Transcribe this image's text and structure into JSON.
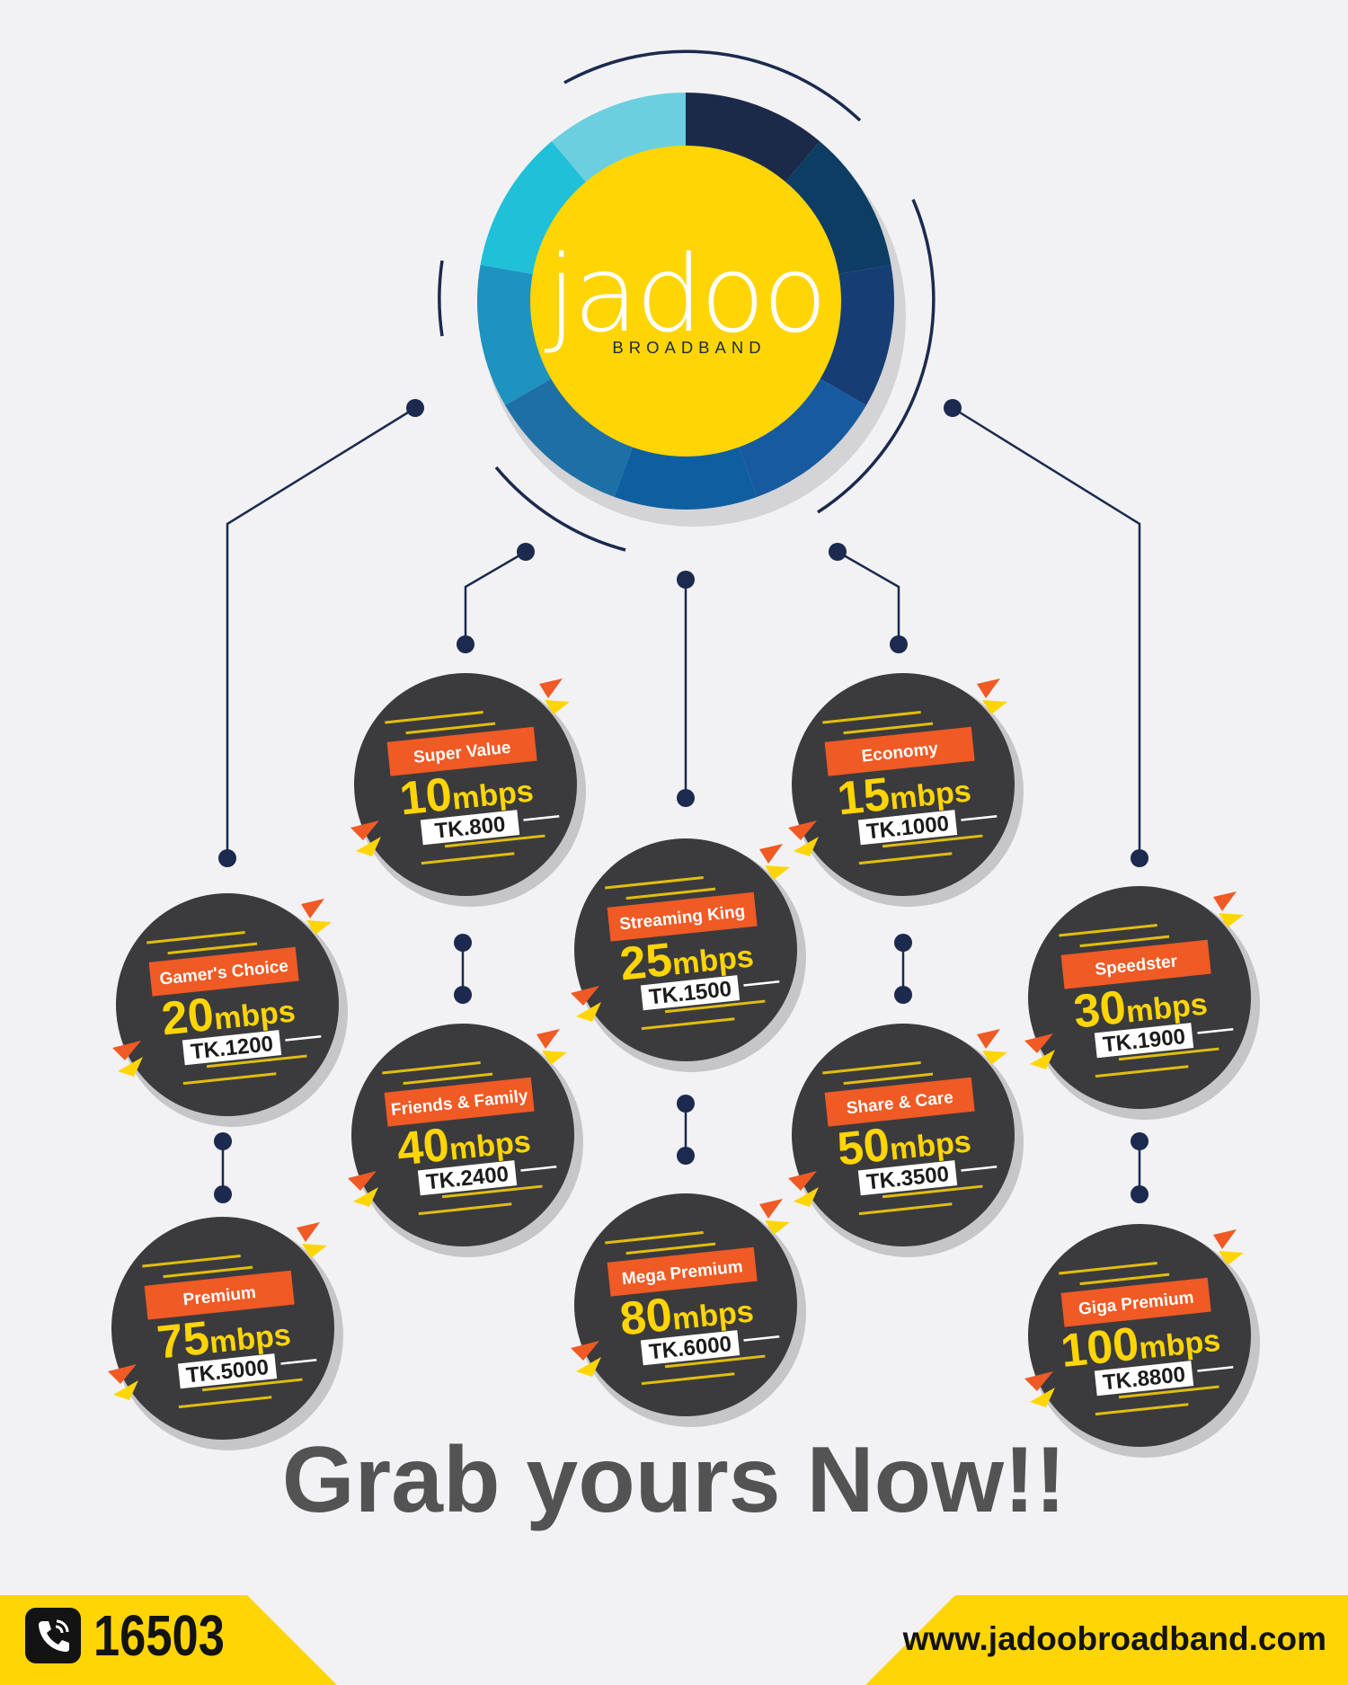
{
  "brand": {
    "name": "jadoo",
    "tagline": "BROADBAND",
    "colors": {
      "yellow": "#ffd505",
      "navy": "#1b2a4e",
      "orange": "#ef5a25",
      "dark": "#3b3b3d"
    }
  },
  "plans": [
    {
      "name": "Super Value",
      "speed": "10",
      "unit": "mbps",
      "price": "TK.800"
    },
    {
      "name": "Economy",
      "speed": "15",
      "unit": "mbps",
      "price": "TK.1000"
    },
    {
      "name": "Gamer's Choice",
      "speed": "20",
      "unit": "mbps",
      "price": "TK.1200"
    },
    {
      "name": "Streaming King",
      "speed": "25",
      "unit": "mbps",
      "price": "TK.1500"
    },
    {
      "name": "Speedster",
      "speed": "30",
      "unit": "mbps",
      "price": "TK.1900"
    },
    {
      "name": "Friends & Family",
      "speed": "40",
      "unit": "mbps",
      "price": "TK.2400"
    },
    {
      "name": "Share & Care",
      "speed": "50",
      "unit": "mbps",
      "price": "TK.3500"
    },
    {
      "name": "Premium",
      "speed": "75",
      "unit": "mbps",
      "price": "TK.5000"
    },
    {
      "name": "Mega Premium",
      "speed": "80",
      "unit": "mbps",
      "price": "TK.6000"
    },
    {
      "name": "Giga Premium",
      "speed": "100",
      "unit": "mbps",
      "price": "TK.8800"
    }
  ],
  "headline": "Grab yours Now!!",
  "footer": {
    "hotline": "16503",
    "phone_icon": "phone-icon",
    "website": "www.jadoobroadband.com"
  }
}
